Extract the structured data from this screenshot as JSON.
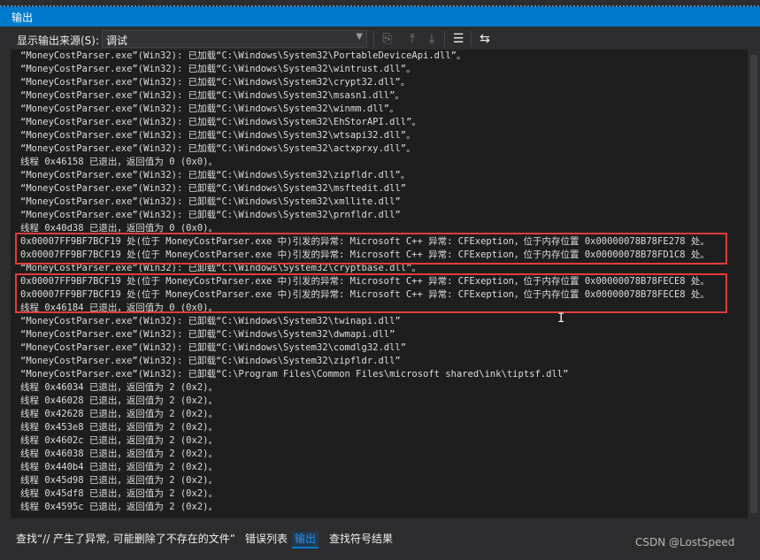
{
  "panel": {
    "title": "输出"
  },
  "toolbar": {
    "source_label": "显示输出来源(S):",
    "source_value": "调试",
    "buttons": [
      {
        "name": "find-message-icon",
        "glyph": "⎘"
      },
      {
        "name": "prev-message-icon",
        "glyph": "⤒"
      },
      {
        "name": "next-message-icon",
        "glyph": "⤓"
      },
      {
        "name": "clear-all-icon",
        "glyph": "☰"
      },
      {
        "name": "word-wrap-icon",
        "glyph": "⇆"
      }
    ]
  },
  "output_lines": [
    "“MoneyCostParser.exe”(Win32): 已加载“C:\\Windows\\System32\\PortableDeviceApi.dll”。",
    "“MoneyCostParser.exe”(Win32): 已加载“C:\\Windows\\System32\\wintrust.dll”。",
    "“MoneyCostParser.exe”(Win32): 已加载“C:\\Windows\\System32\\crypt32.dll”。",
    "“MoneyCostParser.exe”(Win32): 已加载“C:\\Windows\\System32\\msasn1.dll”。",
    "“MoneyCostParser.exe”(Win32): 已加载“C:\\Windows\\System32\\winmm.dll”。",
    "“MoneyCostParser.exe”(Win32): 已加载“C:\\Windows\\System32\\EhStorAPI.dll”。",
    "“MoneyCostParser.exe”(Win32): 已加载“C:\\Windows\\System32\\wtsapi32.dll”。",
    "“MoneyCostParser.exe”(Win32): 已加载“C:\\Windows\\System32\\actxprxy.dll”。",
    "线程 0x46158 已退出，返回值为 0 (0x0)。",
    "“MoneyCostParser.exe”(Win32): 已加载“C:\\Windows\\System32\\zipfldr.dll”。",
    "“MoneyCostParser.exe”(Win32): 已卸载“C:\\Windows\\System32\\msftedit.dll”",
    "“MoneyCostParser.exe”(Win32): 已卸载“C:\\Windows\\System32\\xmllite.dll”",
    "“MoneyCostParser.exe”(Win32): 已卸载“C:\\Windows\\System32\\prnfldr.dll”",
    "线程 0x40d38 已退出，返回值为 0 (0x0)。",
    "0x00007FF9BF7BCF19 处(位于 MoneyCostParser.exe 中)引发的异常: Microsoft C++ 异常: CFExeption，位于内存位置 0x00000078B78FE278 处。",
    "0x00007FF9BF7BCF19 处(位于 MoneyCostParser.exe 中)引发的异常: Microsoft C++ 异常: CFExeption，位于内存位置 0x00000078B78FD1C8 处。",
    "“MoneyCostParser.exe”(Win32): 已卸载“C:\\Windows\\System32\\cryptbase.dll”。",
    "0x00007FF9BF7BCF19 处(位于 MoneyCostParser.exe 中)引发的异常: Microsoft C++ 异常: CFExeption，位于内存位置 0x00000078B78FECE8 处。",
    "0x00007FF9BF7BCF19 处(位于 MoneyCostParser.exe 中)引发的异常: Microsoft C++ 异常: CFExeption，位于内存位置 0x00000078B78FECE8 处。",
    "线程 0x46184 已退出，返回值为 0 (0x0)。",
    "“MoneyCostParser.exe”(Win32): 已卸载“C:\\Windows\\System32\\twinapi.dll”",
    "“MoneyCostParser.exe”(Win32): 已卸载“C:\\Windows\\System32\\dwmapi.dll”",
    "“MoneyCostParser.exe”(Win32): 已卸载“C:\\Windows\\System32\\comdlg32.dll”",
    "“MoneyCostParser.exe”(Win32): 已卸载“C:\\Windows\\System32\\zipfldr.dll”",
    "“MoneyCostParser.exe”(Win32): 已卸载“C:\\Program Files\\Common Files\\microsoft shared\\ink\\tiptsf.dll”",
    "线程 0x46034 已退出，返回值为 2 (0x2)。",
    "线程 0x46028 已退出，返回值为 2 (0x2)。",
    "线程 0x42628 已退出，返回值为 2 (0x2)。",
    "线程 0x453e8 已退出，返回值为 2 (0x2)。",
    "线程 0x4602c 已退出，返回值为 2 (0x2)。",
    "线程 0x46038 已退出，返回值为 2 (0x2)。",
    "线程 0x440b4 已退出，返回值为 2 (0x2)。",
    "线程 0x45d98 已退出，返回值为 2 (0x2)。",
    "线程 0x45df8 已退出，返回值为 2 (0x2)。",
    "线程 0x4595c 已退出，返回值为 2 (0x2)。"
  ],
  "highlight_color": "#e03b3b",
  "bottom_tabs": [
    {
      "label": "查找“// 产生了异常, 可能删除了不存在的文件”",
      "active": false
    },
    {
      "label": "错误列表",
      "active": false
    },
    {
      "label": "输出",
      "active": true
    },
    {
      "label": "查找符号结果",
      "active": false
    }
  ],
  "watermark": "CSDN @LostSpeed"
}
